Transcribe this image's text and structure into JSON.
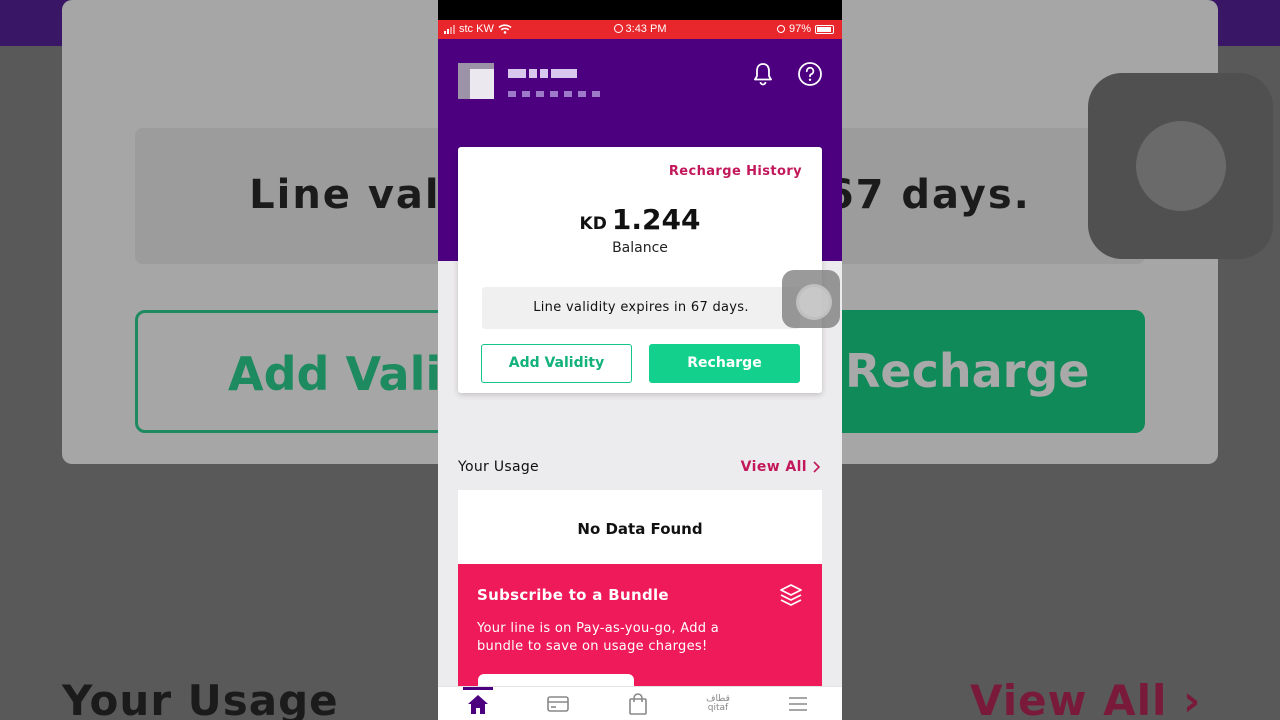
{
  "status_bar": {
    "carrier": "stc KW",
    "time": "3:43 PM",
    "battery": "97%"
  },
  "header": {
    "notification_icon": "bell-icon",
    "help_icon": "question-circle-icon"
  },
  "balance_card": {
    "recharge_history_label": "Recharge History",
    "currency": "KD",
    "amount": "1.244",
    "balance_label": "Balance",
    "validity_text": "Line validity expires in 67 days.",
    "add_validity_label": "Add Validity",
    "recharge_label": "Recharge"
  },
  "usage": {
    "title": "Your Usage",
    "view_all_label": "View All",
    "empty_text": "No Data Found"
  },
  "bundle_promo": {
    "title": "Subscribe to a Bundle",
    "description": "Your line is on Pay-as-you-go, Add a bundle to save on usage charges!",
    "icon": "layers-icon"
  },
  "tab_bar": {
    "qitaf_ar": "قطاف",
    "qitaf_en": "qitaf"
  },
  "colors": {
    "brand_purple": "#4c0080",
    "accent_magenta": "#c2185b",
    "success_green": "#13d18c",
    "promo_pink": "#ee1a5a",
    "status_red": "#e8272d"
  }
}
